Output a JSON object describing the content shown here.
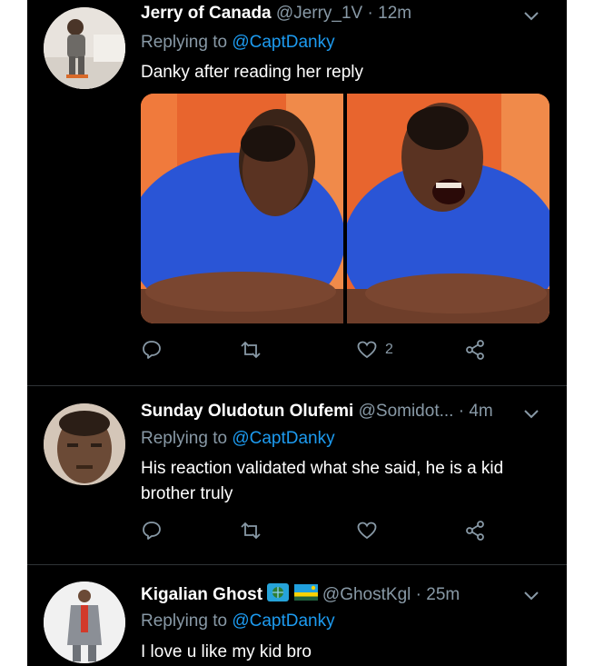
{
  "tweets": [
    {
      "name": "Jerry of Canada",
      "handle": "@Jerry_1V",
      "sep": "·",
      "time": "12m",
      "replying_prefix": "Replying to",
      "replying_to": "@CaptDanky",
      "text": "Danky after reading her reply",
      "likes": "2"
    },
    {
      "name": "Sunday Oludotun Olufemi",
      "handle": "@Somidot...",
      "sep": "·",
      "time": "4m",
      "replying_prefix": "Replying to",
      "replying_to": "@CaptDanky",
      "text": "His reaction validated what she said, he is a kid brother truly"
    },
    {
      "name": "Kigalian Ghost",
      "handle": "@GhostKgl",
      "sep": "·",
      "time": "25m",
      "replying_prefix": "Replying to",
      "replying_to": "@CaptDanky",
      "text": "I love u like my kid bro"
    }
  ],
  "icons": [
    "reply-icon",
    "retweet-icon",
    "like-icon",
    "share-icon",
    "chevron-down-icon"
  ],
  "colors": {
    "background": "#000000",
    "link": "#1d9bf0",
    "muted": "#8899a6",
    "shirt": "#2a55d6",
    "wall": "#e8652e"
  }
}
